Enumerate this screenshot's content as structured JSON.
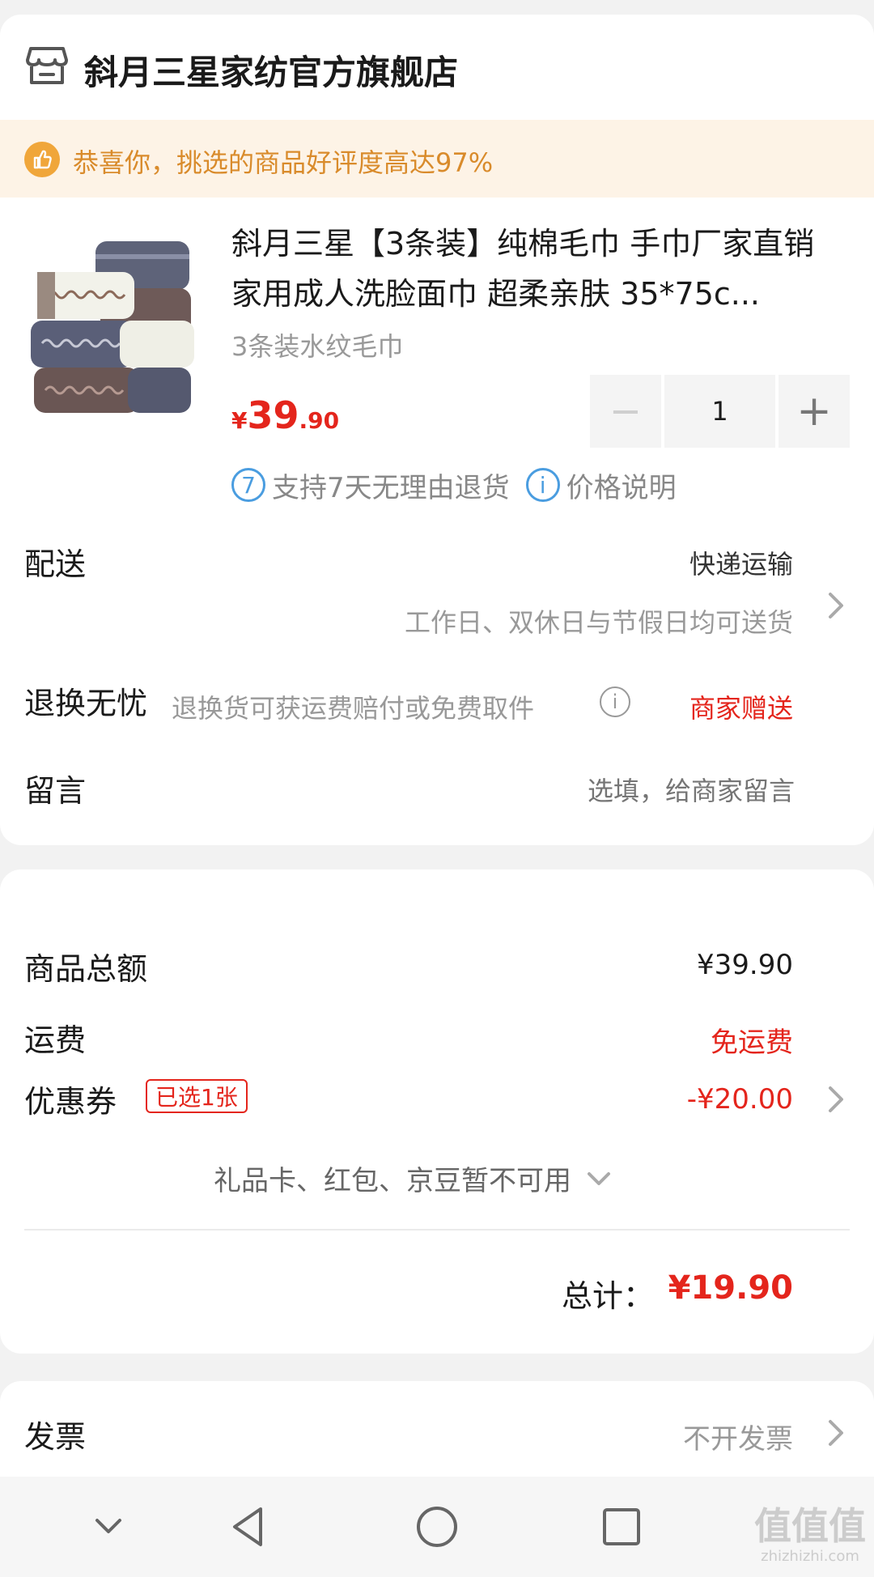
{
  "store": {
    "name": "斜月三星家纺官方旗舰店",
    "rating_banner": "恭喜你，挑选的商品好评度高达97%"
  },
  "product": {
    "title": "斜月三星【3条装】纯棉毛巾 手巾厂家直销 家用成人洗脸面巾 超柔亲肤 35*75c...",
    "spec": "3条装水纹毛巾",
    "price_currency": "¥",
    "price_int": "39",
    "price_dec": ".90",
    "quantity": "1",
    "minus": "−",
    "plus": "+",
    "guarantee_badge": "7",
    "guarantee_text": "支持7天无理由退货",
    "price_info_badge": "i",
    "price_info_text": "价格说明"
  },
  "delivery": {
    "label": "配送",
    "method": "快递运输",
    "note": "工作日、双休日与节假日均可送货"
  },
  "returns": {
    "label": "退换无忧",
    "desc": "退换货可获运费赔付或免费取件",
    "info": "i",
    "value": "商家赠送"
  },
  "message": {
    "label": "留言",
    "placeholder": "选填，给商家留言"
  },
  "totals": {
    "goods_label": "商品总额",
    "goods_value": "¥39.90",
    "shipping_label": "运费",
    "shipping_value": "免运费",
    "coupon_label": "优惠券",
    "coupon_badge": "已选1张",
    "coupon_value": "-¥20.00",
    "unavailable": "礼品卡、红包、京豆暂不可用",
    "total_label": "总计：",
    "total_value": "¥19.90"
  },
  "invoice": {
    "label": "发票",
    "value": "不开发票"
  },
  "watermark": {
    "logo": "值值值",
    "url": "zhizhizhi.com"
  },
  "colors": {
    "accent_red": "#e4251c",
    "banner_bg": "#fdf3e6",
    "banner_text": "#d98b2b",
    "info_blue": "#4a9de0"
  },
  "icons": [
    "store-icon",
    "thumbs-up-icon",
    "minus-icon",
    "plus-icon",
    "chevron-right-icon",
    "info-icon",
    "chevron-down-icon",
    "nav-back-icon",
    "nav-home-icon",
    "nav-recents-icon",
    "nav-collapse-icon"
  ]
}
